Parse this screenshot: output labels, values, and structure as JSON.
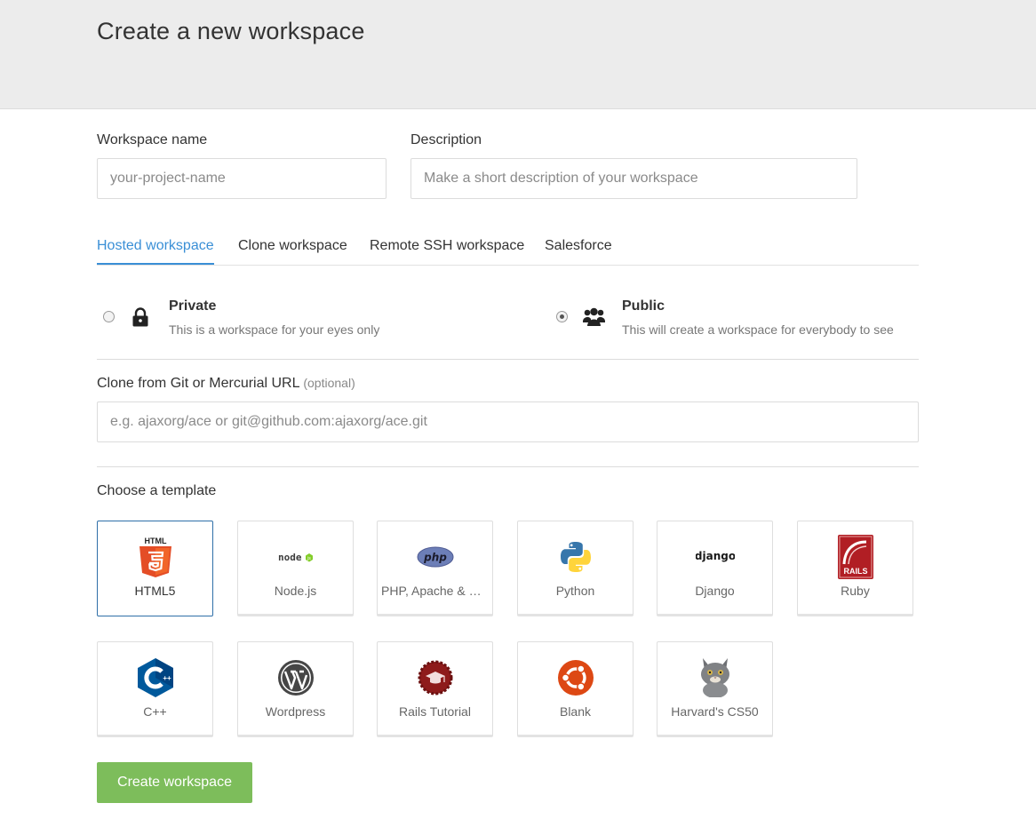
{
  "header": {
    "title": "Create a new workspace"
  },
  "form": {
    "name_label": "Workspace name",
    "name_placeholder": "your-project-name",
    "desc_label": "Description",
    "desc_placeholder": "Make a short description of your workspace"
  },
  "tabs": [
    {
      "label": "Hosted workspace",
      "active": true
    },
    {
      "label": "Clone workspace"
    },
    {
      "label": "Remote SSH workspace"
    },
    {
      "label": "Salesforce"
    }
  ],
  "visibility": {
    "private": {
      "title": "Private",
      "desc": "This is a workspace for your eyes only",
      "checked": false,
      "icon": "lock-icon"
    },
    "public": {
      "title": "Public",
      "desc": "This will create a workspace for everybody to see",
      "checked": true,
      "icon": "users-icon"
    }
  },
  "clone": {
    "label": "Clone from Git or Mercurial URL",
    "optional": "(optional)",
    "placeholder": "e.g. ajaxorg/ace or git@github.com:ajaxorg/ace.git"
  },
  "templates": {
    "label": "Choose a template",
    "items": [
      {
        "name": "HTML5",
        "icon": "html5-icon",
        "logo_text": "HTML",
        "selected": true
      },
      {
        "name": "Node.js",
        "icon": "nodejs-icon",
        "logo_text": "node"
      },
      {
        "name": "PHP, Apache & MySQL",
        "icon": "php-icon",
        "logo_text": "php"
      },
      {
        "name": "Python",
        "icon": "python-icon"
      },
      {
        "name": "Django",
        "icon": "django-icon",
        "logo_text": "django"
      },
      {
        "name": "Ruby",
        "icon": "rails-icon",
        "logo_text": "RAILS"
      },
      {
        "name": "C++",
        "icon": "cpp-icon",
        "logo_text": "C++"
      },
      {
        "name": "Wordpress",
        "icon": "wordpress-icon"
      },
      {
        "name": "Rails Tutorial",
        "icon": "rails-tutorial-icon"
      },
      {
        "name": "Blank",
        "icon": "ubuntu-icon"
      },
      {
        "name": "Harvard's CS50",
        "icon": "cs50-cat-icon"
      }
    ]
  },
  "submit": {
    "label": "Create workspace"
  },
  "colors": {
    "accent": "#3a8fd6",
    "button": "#7dbd5b",
    "header_bg": "#ececec"
  }
}
